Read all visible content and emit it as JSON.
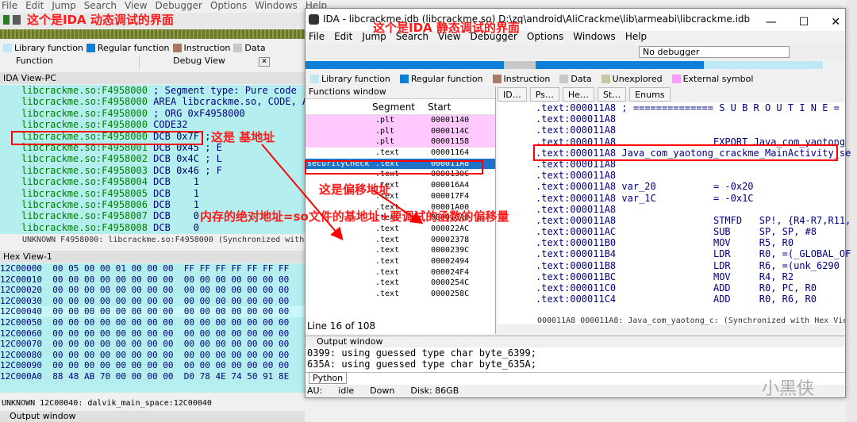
{
  "annotations": {
    "left_title": "这个是IDA 动态调试的界面",
    "right_title": "这个是IDA 静态调试的界面",
    "base_addr": "这是 基地址",
    "offset_addr": "这是偏移地址",
    "formula": "内存的绝对地址=so文件的基地址+要调试的函数的偏移量"
  },
  "left": {
    "menu": [
      "File",
      "Edit",
      "Jump",
      "Search",
      "View",
      "Debugger",
      "Options",
      "Windows",
      "Help"
    ],
    "legend": [
      {
        "label": "Library function",
        "color": "#bfe8f6"
      },
      {
        "label": "Regular function",
        "color": "#0c7fd6"
      },
      {
        "label": "Instruction",
        "color": "#a87a66"
      },
      {
        "label": "Data",
        "color": "#c8c8c8"
      }
    ],
    "tab_function": "Function",
    "tab_debug": "Debug View",
    "idaview_title": "IDA View-PC",
    "code": [
      {
        "addr": "libcrackme.so:F4958000",
        "rest": " ; Segment type: Pure code"
      },
      {
        "addr": "libcrackme.so:F4958000",
        "rest": " AREA libcrackme.so, CODE, ALIGN"
      },
      {
        "addr": "libcrackme.so:F4958000",
        "rest": " ; ORG 0xF4958000"
      },
      {
        "addr": "libcrackme.so:F4958000",
        "rest": " CODE32"
      },
      {
        "addr": "libcrackme.so:F4958000",
        "rest": " DCB 0x7F ;"
      },
      {
        "addr": "libcrackme.so:F4958001",
        "rest": " DCB 0x45 ; E"
      },
      {
        "addr": "libcrackme.so:F4958002",
        "rest": " DCB 0x4C ; L"
      },
      {
        "addr": "libcrackme.so:F4958003",
        "rest": " DCB 0x46 ; F"
      },
      {
        "addr": "libcrackme.so:F4958004",
        "rest": " DCB    1"
      },
      {
        "addr": "libcrackme.so:F4958005",
        "rest": " DCB    1"
      },
      {
        "addr": "libcrackme.so:F4958006",
        "rest": " DCB    1"
      },
      {
        "addr": "libcrackme.so:F4958007",
        "rest": " DCB    0"
      },
      {
        "addr": "libcrackme.so:F4958008",
        "rest": " DCB    0"
      }
    ],
    "status1": "UNKNOWN F4958000: libcrackme.so:F4958000 (Synchronized with PC)",
    "hex_title": "Hex View-1",
    "hex": [
      "12C00000  00 05 00 00 01 00 00 00  FF FF FF FF FF FF FF",
      "12C00010  00 00 00 00 00 00 00 00  00 00 00 00 00 00 00",
      "12C00020  00 00 00 00 00 00 00 00  00 00 00 00 00 00 00",
      "12C00030  00 00 00 00 00 00 00 00  00 00 00 00 00 00 00",
      "12C00040  00 00 00 00 00 00 00 00  00 00 00 00 00 00 00",
      "12C00050  00 00 00 00 00 00 00 00  00 00 00 00 00 00 00",
      "12C00060  00 00 00 00 00 00 00 00  00 00 00 00 00 00 00",
      "12C00070  00 00 00 00 00 00 00 00  00 00 00 00 00 00 00",
      "12C00080  00 00 00 00 00 00 00 00  00 00 00 00 00 00 00",
      "12C00090  00 00 00 00 00 00 00 00  00 00 00 00 00 00 00",
      "12C000A0  88 48 AB 70 00 00 00 00  D0 78 4E 74 50 91 8E"
    ],
    "status2": "UNKNOWN 12C00040: dalvik_main_space:12C00040",
    "output": "Output window"
  },
  "right": {
    "title": "IDA - libcrackme.idb (libcrackme.so) D:\\zq\\android\\AliCrackme\\lib\\armeabi\\libcrackme.idb",
    "menu": [
      "File",
      "Edit",
      "Jump",
      "Search",
      "View",
      "Debugger",
      "Options",
      "Windows",
      "Help"
    ],
    "debugger_select": "No debugger",
    "legend": [
      {
        "label": "Library function",
        "color": "#bfe8f6"
      },
      {
        "label": "Regular function",
        "color": "#0c7fd6"
      },
      {
        "label": "Instruction",
        "color": "#a87a66"
      },
      {
        "label": "Data",
        "color": "#c8c8c8"
      },
      {
        "label": "Unexplored",
        "color": "#c8c8a0"
      },
      {
        "label": "External symbol",
        "color": "#ff99ff"
      }
    ],
    "functions_title": "Functions window",
    "col_segment": "Segment",
    "col_start": "Start",
    "functions": [
      {
        "name": "",
        "seg": ".plt",
        "start": "00001140",
        "style": "pink"
      },
      {
        "name": "",
        "seg": ".plt",
        "start": "0000114C",
        "style": "pink"
      },
      {
        "name": "",
        "seg": ".plt",
        "start": "00001158",
        "style": "pink"
      },
      {
        "name": "",
        "seg": ".text",
        "start": "00001164",
        "style": ""
      },
      {
        "name": "securityCheck",
        "seg": ".text",
        "start": "000011A8",
        "style": "sel"
      },
      {
        "name": "",
        "seg": ".text",
        "start": "0000130C",
        "style": ""
      },
      {
        "name": "",
        "seg": ".text",
        "start": "000016A4",
        "style": ""
      },
      {
        "name": "",
        "seg": ".text",
        "start": "000017F4",
        "style": ""
      },
      {
        "name": "",
        "seg": ".text",
        "start": "00001A00",
        "style": ""
      },
      {
        "name": "",
        "seg": ".text",
        "start": "00001CA8",
        "style": ""
      },
      {
        "name": "",
        "seg": ".text",
        "start": "000022AC",
        "style": ""
      },
      {
        "name": "",
        "seg": ".text",
        "start": "00002378",
        "style": ""
      },
      {
        "name": "",
        "seg": ".text",
        "start": "0000239C",
        "style": ""
      },
      {
        "name": "",
        "seg": ".text",
        "start": "00002494",
        "style": ""
      },
      {
        "name": "",
        "seg": ".text",
        "start": "000024F4",
        "style": ""
      },
      {
        "name": "",
        "seg": ".text",
        "start": "0000254C",
        "style": ""
      },
      {
        "name": "",
        "seg": ".text",
        "start": "0000258C",
        "style": ""
      }
    ],
    "line_info": "Line 16 of 108",
    "tabs": [
      "ID…",
      "Ps…",
      "He…",
      "St…",
      "Enums"
    ],
    "code": [
      ".text:000011A8 ; ============== S U B R O U T I N E =",
      ".text:000011A8",
      ".text:000011A8",
      ".text:000011A8                 EXPORT Java_com_yaotong",
      ".text:000011A8 Java_com_yaotong_crackme_MainActivity_se",
      ".text:000011A8",
      ".text:000011A8",
      ".text:000011A8 var_20          = -0x20",
      ".text:000011A8 var_1C          = -0x1C",
      ".text:000011A8",
      ".text:000011A8                 STMFD   SP!, {R4-R7,R11,",
      ".text:000011AC                 SUB     SP, SP, #8",
      ".text:000011B0                 MOV     R5, R0",
      ".text:000011B4                 LDR     R0, =(_GLOBAL_OF",
      ".text:000011B8                 LDR     R6, =(unk_6290",
      ".text:000011BC                 MOV     R4, R2",
      ".text:000011C0                 ADD     R0, PC, R0",
      ".text:000011C4                 ADD     R0, R6, R0"
    ],
    "code_status": "000011A8 000011A8: Java_com_yaotong_c: (Synchronized with Hex View-1)",
    "output_title": "Output window",
    "output": [
      "0399: using guessed type char byte_6399;",
      "635A: using guessed type char byte_635A;"
    ],
    "python_btn": "Python",
    "status": {
      "au": "AU:",
      "state": "idle",
      "dir": "Down",
      "disk": "Disk: 86GB"
    }
  },
  "watermark": "小黑侠"
}
